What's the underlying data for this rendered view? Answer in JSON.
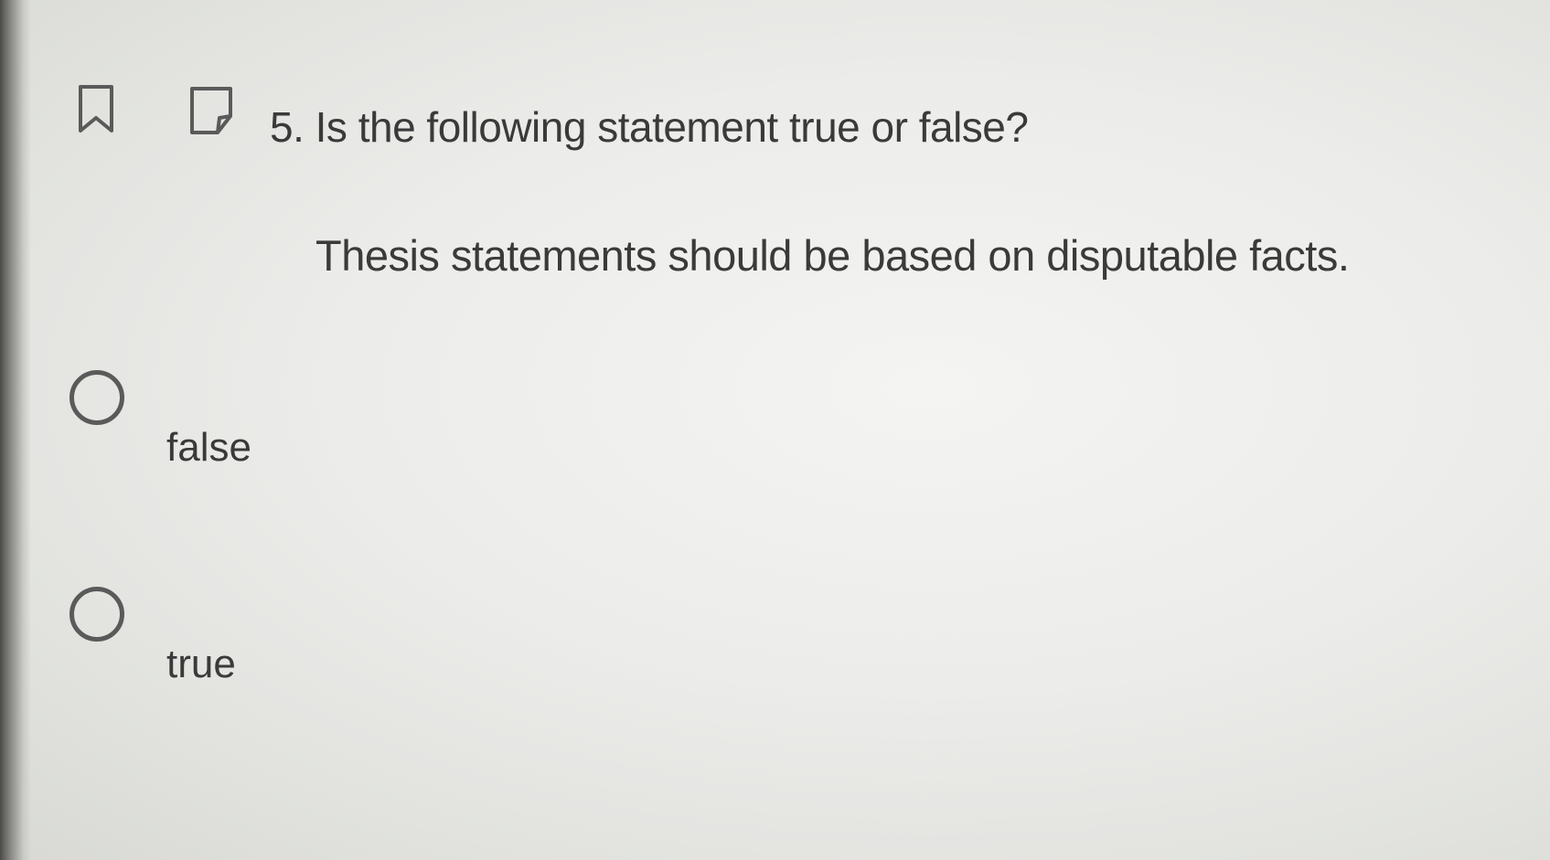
{
  "question": {
    "title": "5. Is the following statement true or false?",
    "statement": "Thesis statements should be based on disputable facts."
  },
  "toolbar": {
    "bookmark_icon": "bookmark-icon",
    "flag_icon": "flag-icon"
  },
  "options": [
    {
      "label": "false",
      "selected": false
    },
    {
      "label": "true",
      "selected": false
    }
  ],
  "colors": {
    "text": "#3a3a3a",
    "radio_border": "#5a5a5a",
    "background": "#ececea"
  }
}
